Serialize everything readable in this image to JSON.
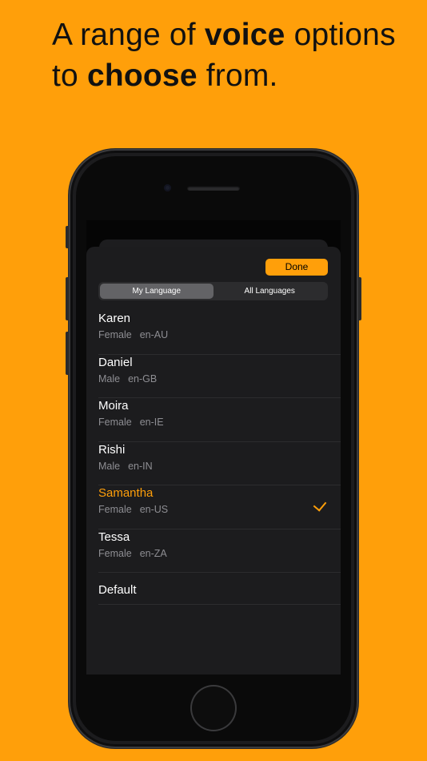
{
  "headline": {
    "part1": "A range of ",
    "bold1": "voice",
    "part2": " options to ",
    "bold2": "choose",
    "part3": " from."
  },
  "colors": {
    "background": "#FF9F0A",
    "accent": "#FF9F0A",
    "sheet": "#1C1C1E"
  },
  "sheet": {
    "done_label": "Done",
    "segments": [
      "My Language",
      "All Languages"
    ],
    "selected_segment": "My Language"
  },
  "voices": [
    {
      "name": "Karen",
      "gender": "Female",
      "locale": "en-AU",
      "selected": false
    },
    {
      "name": "Daniel",
      "gender": "Male",
      "locale": "en-GB",
      "selected": false
    },
    {
      "name": "Moira",
      "gender": "Female",
      "locale": "en-IE",
      "selected": false
    },
    {
      "name": "Rishi",
      "gender": "Male",
      "locale": "en-IN",
      "selected": false
    },
    {
      "name": "Samantha",
      "gender": "Female",
      "locale": "en-US",
      "selected": true
    },
    {
      "name": "Tessa",
      "gender": "Female",
      "locale": "en-ZA",
      "selected": false
    }
  ],
  "default_label": "Default",
  "icons": {
    "selected_marker": "checkmark-icon"
  }
}
